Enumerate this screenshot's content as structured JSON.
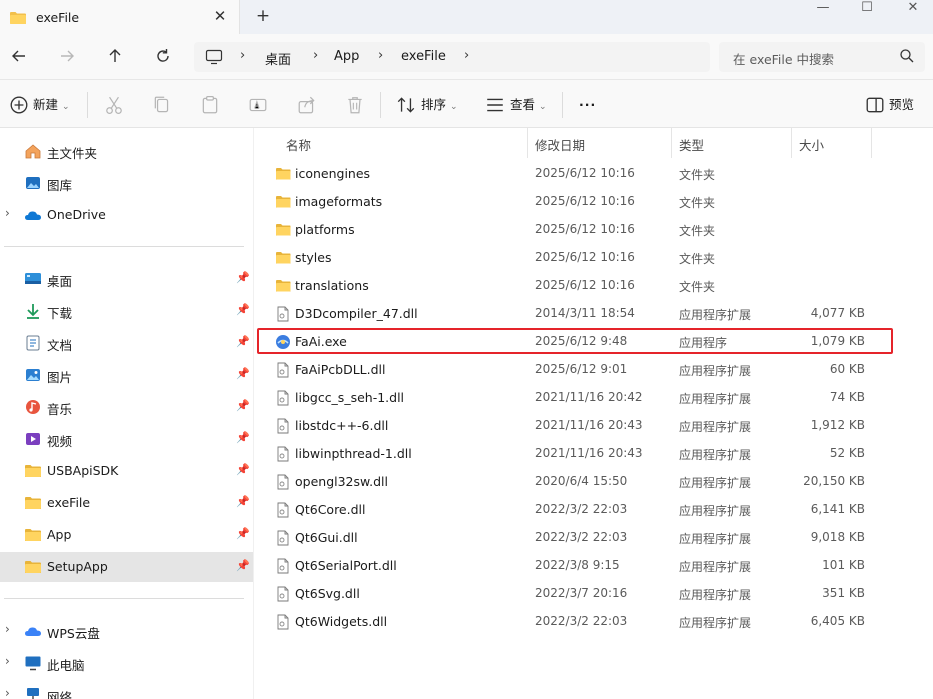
{
  "window": {
    "tab_title": "exeFile",
    "new_tab": "+",
    "minimize": "—",
    "maximize": "☐",
    "close": "✕"
  },
  "navbar": {
    "breadcrumbs": [
      "桌面",
      "App",
      "exeFile"
    ],
    "search_placeholder": "在 exeFile 中搜索"
  },
  "toolbar": {
    "new_label": "新建",
    "sort_label": "排序",
    "view_label": "查看",
    "more_label": "···",
    "preview_label": "预览"
  },
  "sidebar": {
    "top_items": [
      {
        "label": "主文件夹",
        "icon": "home-icon"
      },
      {
        "label": "图库",
        "icon": "gallery-icon"
      },
      {
        "label": "OneDrive",
        "icon": "onedrive-icon"
      }
    ],
    "pinned_items": [
      {
        "label": "桌面",
        "icon": "desktop-icon"
      },
      {
        "label": "下载",
        "icon": "download-icon"
      },
      {
        "label": "文档",
        "icon": "documents-icon"
      },
      {
        "label": "图片",
        "icon": "pictures-icon"
      },
      {
        "label": "音乐",
        "icon": "music-icon"
      },
      {
        "label": "视频",
        "icon": "videos-icon"
      },
      {
        "label": "USBApiSDK",
        "icon": "folder-icon"
      },
      {
        "label": "exeFile",
        "icon": "folder-icon"
      },
      {
        "label": "App",
        "icon": "folder-icon"
      },
      {
        "label": "SetupApp",
        "icon": "folder-icon",
        "selected": true
      }
    ],
    "bottom_items": [
      {
        "label": "WPS云盘",
        "icon": "wps-cloud-icon"
      },
      {
        "label": "此电脑",
        "icon": "this-pc-icon"
      },
      {
        "label": "网络",
        "icon": "network-icon"
      }
    ]
  },
  "columns": {
    "name": "名称",
    "date": "修改日期",
    "type": "类型",
    "size": "大小"
  },
  "files": [
    {
      "name": "iconengines",
      "date": "2025/6/12 10:16",
      "type": "文件夹",
      "size": "",
      "kind": "folder"
    },
    {
      "name": "imageformats",
      "date": "2025/6/12 10:16",
      "type": "文件夹",
      "size": "",
      "kind": "folder"
    },
    {
      "name": "platforms",
      "date": "2025/6/12 10:16",
      "type": "文件夹",
      "size": "",
      "kind": "folder"
    },
    {
      "name": "styles",
      "date": "2025/6/12 10:16",
      "type": "文件夹",
      "size": "",
      "kind": "folder"
    },
    {
      "name": "translations",
      "date": "2025/6/12 10:16",
      "type": "文件夹",
      "size": "",
      "kind": "folder"
    },
    {
      "name": "D3Dcompiler_47.dll",
      "date": "2014/3/11 18:54",
      "type": "应用程序扩展",
      "size": "4,077 KB",
      "kind": "dll"
    },
    {
      "name": "FaAi.exe",
      "date": "2025/6/12 9:48",
      "type": "应用程序",
      "size": "1,079 KB",
      "kind": "exe",
      "highlighted": true
    },
    {
      "name": "FaAiPcbDLL.dll",
      "date": "2025/6/12 9:01",
      "type": "应用程序扩展",
      "size": "60 KB",
      "kind": "dll"
    },
    {
      "name": "libgcc_s_seh-1.dll",
      "date": "2021/11/16 20:42",
      "type": "应用程序扩展",
      "size": "74 KB",
      "kind": "dll"
    },
    {
      "name": "libstdc++-6.dll",
      "date": "2021/11/16 20:43",
      "type": "应用程序扩展",
      "size": "1,912 KB",
      "kind": "dll"
    },
    {
      "name": "libwinpthread-1.dll",
      "date": "2021/11/16 20:43",
      "type": "应用程序扩展",
      "size": "52 KB",
      "kind": "dll"
    },
    {
      "name": "opengl32sw.dll",
      "date": "2020/6/4 15:50",
      "type": "应用程序扩展",
      "size": "20,150 KB",
      "kind": "dll"
    },
    {
      "name": "Qt6Core.dll",
      "date": "2022/3/2 22:03",
      "type": "应用程序扩展",
      "size": "6,141 KB",
      "kind": "dll"
    },
    {
      "name": "Qt6Gui.dll",
      "date": "2022/3/2 22:03",
      "type": "应用程序扩展",
      "size": "9,018 KB",
      "kind": "dll"
    },
    {
      "name": "Qt6SerialPort.dll",
      "date": "2022/3/8 9:15",
      "type": "应用程序扩展",
      "size": "101 KB",
      "kind": "dll"
    },
    {
      "name": "Qt6Svg.dll",
      "date": "2022/3/7 20:16",
      "type": "应用程序扩展",
      "size": "351 KB",
      "kind": "dll"
    },
    {
      "name": "Qt6Widgets.dll",
      "date": "2022/3/2 22:03",
      "type": "应用程序扩展",
      "size": "6,405 KB",
      "kind": "dll"
    }
  ],
  "colors": {
    "folder": "#f2c04c",
    "highlight": "#e5242a",
    "selected_bg": "#e5e5e5",
    "accent": "#0067c0"
  }
}
